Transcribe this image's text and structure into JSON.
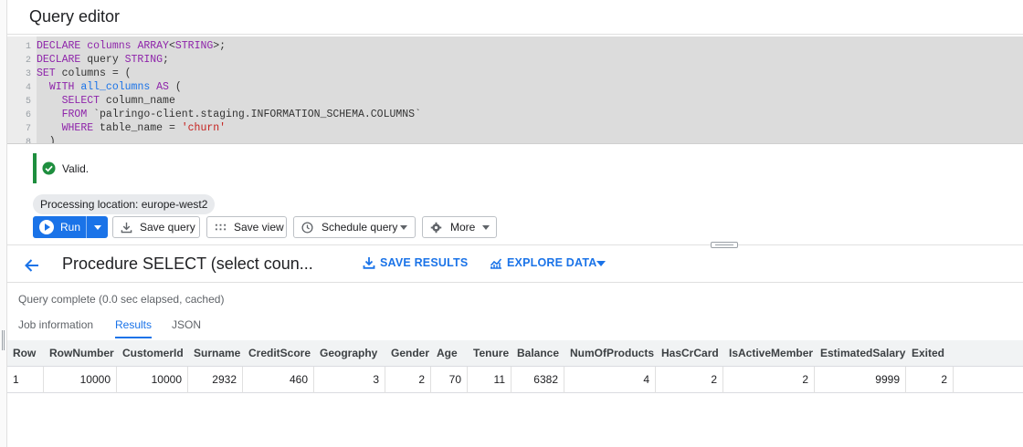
{
  "editor": {
    "title": "Query editor",
    "lines": [
      {
        "n": "1",
        "parts": [
          [
            "kw",
            "DECLARE"
          ],
          [
            "tx",
            " "
          ],
          [
            "kw",
            "columns"
          ],
          [
            "tx",
            " "
          ],
          [
            "kw",
            "ARRAY"
          ],
          [
            "tx",
            "<"
          ],
          [
            "kw",
            "STRING"
          ],
          [
            "tx",
            ">;"
          ]
        ]
      },
      {
        "n": "2",
        "parts": [
          [
            "kw",
            "DECLARE"
          ],
          [
            "tx",
            " query "
          ],
          [
            "kw",
            "STRING"
          ],
          [
            "tx",
            ";"
          ]
        ]
      },
      {
        "n": "3",
        "parts": [
          [
            "kw",
            "SET"
          ],
          [
            "tx",
            " columns = ("
          ]
        ]
      },
      {
        "n": "4",
        "parts": [
          [
            "tx",
            "  "
          ],
          [
            "kw",
            "WITH"
          ],
          [
            "tx",
            " "
          ],
          [
            "fn",
            "all_columns"
          ],
          [
            "tx",
            " "
          ],
          [
            "kw",
            "AS"
          ],
          [
            "tx",
            " ("
          ]
        ]
      },
      {
        "n": "5",
        "parts": [
          [
            "tx",
            "    "
          ],
          [
            "kw",
            "SELECT"
          ],
          [
            "tx",
            " column_name"
          ]
        ]
      },
      {
        "n": "6",
        "parts": [
          [
            "tx",
            "    "
          ],
          [
            "kw",
            "FROM"
          ],
          [
            "tx",
            " `palringo-client.staging.INFORMATION_SCHEMA.COLUMNS`"
          ]
        ]
      },
      {
        "n": "7",
        "parts": [
          [
            "tx",
            "    "
          ],
          [
            "kw",
            "WHERE"
          ],
          [
            "tx",
            " table_name = "
          ],
          [
            "str",
            "'churn'"
          ]
        ]
      },
      {
        "n": "8",
        "parts": [
          [
            "tx",
            "  )"
          ]
        ]
      }
    ]
  },
  "validation": {
    "text": "Valid."
  },
  "location": {
    "text": "Processing location: europe-west2"
  },
  "toolbar": {
    "run": "Run",
    "save_query": "Save query",
    "save_view": "Save view",
    "schedule_query": "Schedule query",
    "more": "More"
  },
  "results": {
    "title": "Procedure SELECT (select coun...",
    "save_results": "SAVE RESULTS",
    "explore_data": "EXPLORE DATA",
    "status": "Query complete (0.0 sec elapsed, cached)",
    "tabs": [
      "Job information",
      "Results",
      "JSON"
    ],
    "active_tab": "Results"
  },
  "table": {
    "columns": [
      "Row",
      "RowNumber",
      "CustomerId",
      "Surname",
      "CreditScore",
      "Geography",
      "Gender",
      "Age",
      "Tenure",
      "Balance",
      "NumOfProducts",
      "HasCrCard",
      "IsActiveMember",
      "EstimatedSalary",
      "Exited"
    ],
    "rows": [
      [
        "1",
        "10000",
        "10000",
        "2932",
        "460",
        "3",
        "2",
        "70",
        "11",
        "6382",
        "4",
        "2",
        "2",
        "9999",
        "2"
      ]
    ]
  },
  "colors": {
    "accent": "#1a73e8",
    "valid_green": "#1e8e3e",
    "editor_bg": "#dcdcdc",
    "keyword": "#8e24aa",
    "string": "#c5221f"
  },
  "icons": {
    "valid": "check-circle-icon",
    "run": "play-icon",
    "save_query": "save-icon",
    "save_view": "grid-icon",
    "schedule": "clock-icon",
    "more": "gear-icon",
    "back": "arrow-left-icon",
    "save_results": "download-icon",
    "explore": "chart-icon"
  }
}
